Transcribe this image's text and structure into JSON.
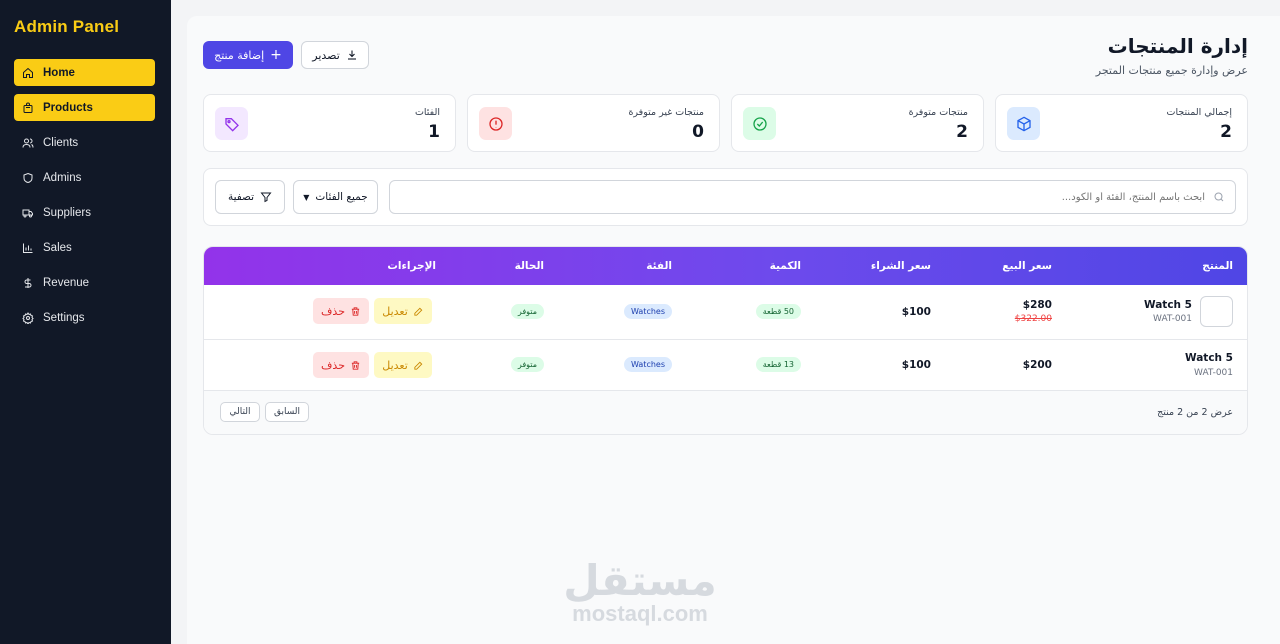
{
  "sidebar": {
    "brand": "Admin Panel",
    "items": [
      {
        "label": "Home",
        "icon": "home-icon"
      },
      {
        "label": "Products",
        "icon": "bag-icon"
      },
      {
        "label": "Clients",
        "icon": "users-icon"
      },
      {
        "label": "Admins",
        "icon": "shield-icon"
      },
      {
        "label": "Suppliers",
        "icon": "truck-icon"
      },
      {
        "label": "Sales",
        "icon": "bar-chart-icon"
      },
      {
        "label": "Revenue",
        "icon": "dollar-icon"
      },
      {
        "label": "Settings",
        "icon": "gear-icon"
      }
    ],
    "active_color": "#facc15",
    "bg_color": "#111827"
  },
  "header": {
    "title": "إدارة المنتجات",
    "subtitle": "عرض وإدارة جميع منتجات المتجر",
    "add_label": "إضافة منتج",
    "export_label": "تصدير",
    "accent": "#4f46e5"
  },
  "stats": [
    {
      "label": "إجمالي المنتجات",
      "value": "2",
      "icon": "cube-icon",
      "color": "#2563eb"
    },
    {
      "label": "منتجات متوفرة",
      "value": "2",
      "icon": "check-circle-icon",
      "color": "#16a34a"
    },
    {
      "label": "منتجات غير متوفرة",
      "value": "0",
      "icon": "alert-circle-icon",
      "color": "#dc2626"
    },
    {
      "label": "الفئات",
      "value": "1",
      "icon": "tag-icon",
      "color": "#9333ea"
    }
  ],
  "filters": {
    "search_placeholder": "ابحث باسم المنتج، الفئة أو الكود...",
    "category_value": "جميع الفئات",
    "filter_label": "تصفية"
  },
  "table": {
    "headers": {
      "product": "المنتج",
      "sell_price": "سعر البيع",
      "buy_price": "سعر الشراء",
      "quantity": "الكمية",
      "category": "الفئة",
      "status": "الحالة",
      "actions": "الإجراءات"
    },
    "rows": [
      {
        "name": "Watch 5",
        "sku": "WAT-001",
        "sell_price": "$280",
        "old_price": "$322.00",
        "buy_price": "$100",
        "quantity": "50 قطعة",
        "category": "Watches",
        "status": "متوفر"
      },
      {
        "name": "Watch 5",
        "sku": "WAT-001",
        "sell_price": "$200",
        "old_price": "",
        "buy_price": "$100",
        "quantity": "13 قطعة",
        "category": "Watches",
        "status": "متوفر"
      }
    ],
    "edit_label": "تعديل",
    "delete_label": "حذف",
    "footer_info": "عرض 2 من 2 منتج",
    "prev_label": "السابق",
    "next_label": "التالي"
  },
  "watermark": {
    "ar": "مستقل",
    "en": "mostaql.com"
  }
}
